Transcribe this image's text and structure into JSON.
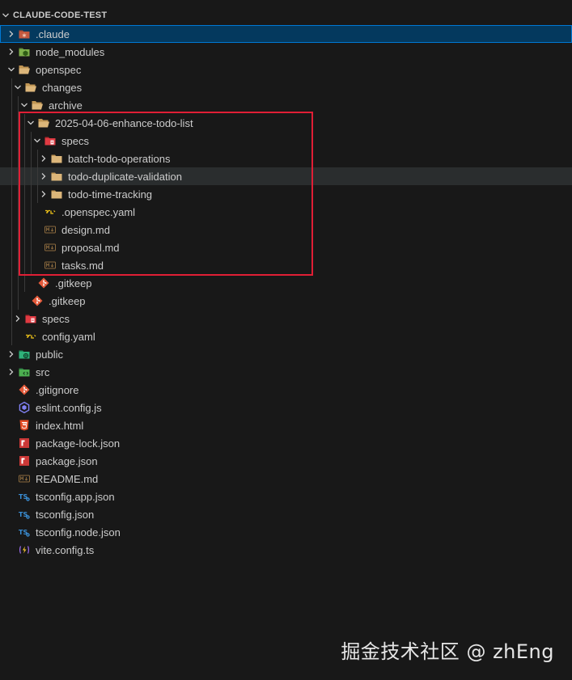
{
  "explorer": {
    "title": "CLAUDE-CODE-TEST"
  },
  "tree": [
    {
      "label": ".claude",
      "icon": "claude-folder-icon",
      "depth": 0,
      "chevron": "right",
      "state": "selected"
    },
    {
      "label": "node_modules",
      "icon": "node-modules-folder-icon",
      "depth": 0,
      "chevron": "right"
    },
    {
      "label": "openspec",
      "icon": "folder-open-icon",
      "depth": 0,
      "chevron": "down"
    },
    {
      "label": "changes",
      "icon": "folder-open-icon",
      "depth": 1,
      "chevron": "down"
    },
    {
      "label": "archive",
      "icon": "folder-open-icon",
      "depth": 2,
      "chevron": "down"
    },
    {
      "label": "2025-04-06-enhance-todo-list",
      "icon": "folder-open-icon",
      "depth": 3,
      "chevron": "down"
    },
    {
      "label": "specs",
      "icon": "specs-folder-icon",
      "depth": 4,
      "chevron": "down"
    },
    {
      "label": "batch-todo-operations",
      "icon": "folder-icon",
      "depth": 5,
      "chevron": "right"
    },
    {
      "label": "todo-duplicate-validation",
      "icon": "folder-icon",
      "depth": 5,
      "chevron": "right",
      "state": "hover"
    },
    {
      "label": "todo-time-tracking",
      "icon": "folder-icon",
      "depth": 5,
      "chevron": "right"
    },
    {
      "label": ".openspec.yaml",
      "icon": "yaml-file-icon",
      "depth": 4,
      "chevron": "none"
    },
    {
      "label": "design.md",
      "icon": "markdown-file-icon",
      "depth": 4,
      "chevron": "none"
    },
    {
      "label": "proposal.md",
      "icon": "markdown-file-icon",
      "depth": 4,
      "chevron": "none"
    },
    {
      "label": "tasks.md",
      "icon": "markdown-file-icon",
      "depth": 4,
      "chevron": "none"
    },
    {
      "label": ".gitkeep",
      "icon": "git-file-icon",
      "depth": 3,
      "chevron": "none"
    },
    {
      "label": ".gitkeep",
      "icon": "git-file-icon",
      "depth": 2,
      "chevron": "none"
    },
    {
      "label": "specs",
      "icon": "specs-folder-icon",
      "depth": 1,
      "chevron": "right"
    },
    {
      "label": "config.yaml",
      "icon": "yaml-file-icon",
      "depth": 1,
      "chevron": "none"
    },
    {
      "label": "public",
      "icon": "public-folder-icon",
      "depth": 0,
      "chevron": "right"
    },
    {
      "label": "src",
      "icon": "src-folder-icon",
      "depth": 0,
      "chevron": "right"
    },
    {
      "label": ".gitignore",
      "icon": "git-file-icon",
      "depth": 0,
      "chevron": "none"
    },
    {
      "label": "eslint.config.js",
      "icon": "eslint-file-icon",
      "depth": 0,
      "chevron": "none"
    },
    {
      "label": "index.html",
      "icon": "html-file-icon",
      "depth": 0,
      "chevron": "none"
    },
    {
      "label": "package-lock.json",
      "icon": "npm-file-icon",
      "depth": 0,
      "chevron": "none"
    },
    {
      "label": "package.json",
      "icon": "npm-file-icon",
      "depth": 0,
      "chevron": "none"
    },
    {
      "label": "README.md",
      "icon": "markdown-file-icon",
      "depth": 0,
      "chevron": "none"
    },
    {
      "label": "tsconfig.app.json",
      "icon": "tsconfig-file-icon",
      "depth": 0,
      "chevron": "none"
    },
    {
      "label": "tsconfig.json",
      "icon": "tsconfig-file-icon",
      "depth": 0,
      "chevron": "none"
    },
    {
      "label": "tsconfig.node.json",
      "icon": "tsconfig-file-icon",
      "depth": 0,
      "chevron": "none"
    },
    {
      "label": "vite.config.ts",
      "icon": "vite-file-icon",
      "depth": 0,
      "chevron": "none"
    }
  ],
  "watermark": "掘金技术社区 @ zhEng",
  "colors": {
    "background": "#181818",
    "selected_background": "#04395e",
    "selected_border": "#0078d4",
    "hover_background": "#2a2d2e",
    "highlight_border": "#e01e35",
    "folder": "#dcb67a"
  }
}
